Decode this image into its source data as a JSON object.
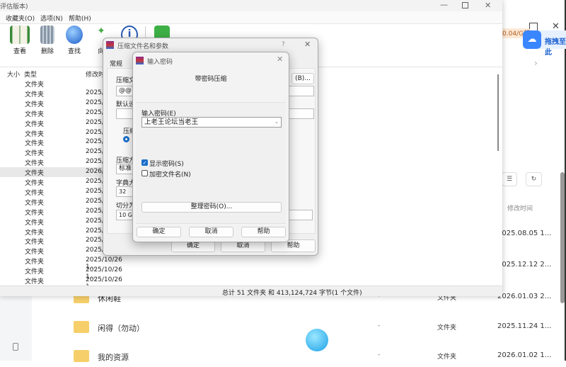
{
  "background_app": {
    "speed_badge": "0.04/G起",
    "drag_upload": "拖拽至此",
    "col_modified": "修改时间",
    "rows": [
      {
        "name": "",
        "type": "",
        "date": "2025.08.05 1..."
      },
      {
        "name": "",
        "type": "",
        "date": "2025.12.12 2..."
      },
      {
        "name": "休闲鞋",
        "type": "文件夹",
        "date": "2026.01.03 2..."
      },
      {
        "name": "闲得（勿动）",
        "type": "文件夹",
        "date": "2025.11.24 1..."
      },
      {
        "name": "我的资源",
        "type": "文件夹",
        "date": "2026.01.02 1..."
      }
    ],
    "dash": "-"
  },
  "winrar": {
    "title": "评估版本)",
    "menu": [
      "收藏夹(O)",
      "选项(N)",
      "帮助(H)"
    ],
    "toolbar": [
      "查看",
      "删除",
      "查找",
      "向",
      "",
      ""
    ],
    "columns": {
      "size": "大小",
      "type": "类型",
      "modified": "修改时"
    },
    "rows": [
      {
        "type": "文件夹",
        "date": ""
      },
      {
        "type": "文件夹",
        "date": "2025/"
      },
      {
        "type": "文件夹",
        "date": "2025/"
      },
      {
        "type": "文件夹",
        "date": "2025/"
      },
      {
        "type": "文件夹",
        "date": "2025/"
      },
      {
        "type": "文件夹",
        "date": "2025/"
      },
      {
        "type": "文件夹",
        "date": "2025/"
      },
      {
        "type": "文件夹",
        "date": "2025/"
      },
      {
        "type": "文件夹",
        "date": "2025/"
      },
      {
        "type": "文件夹",
        "date": "2026/"
      },
      {
        "type": "文件夹",
        "date": "2025/"
      },
      {
        "type": "文件夹",
        "date": "2025/"
      },
      {
        "type": "文件夹",
        "date": "2025/"
      },
      {
        "type": "文件夹",
        "date": "2025/"
      },
      {
        "type": "文件夹",
        "date": "2025/"
      },
      {
        "type": "文件夹",
        "date": "2025/"
      },
      {
        "type": "文件夹",
        "date": "2025/"
      },
      {
        "type": "文件夹",
        "date": "2025/"
      },
      {
        "type": "文件夹",
        "date": "2025/10/26 1..."
      },
      {
        "type": "文件夹",
        "date": "2025/10/26 1..."
      },
      {
        "type": "文件夹",
        "date": "2025/10/26 1..."
      }
    ],
    "status": "总计 51 文件夹 和 413,124,724 字节(1 个文件)"
  },
  "archive_dialog": {
    "title": "压缩文件名和参数",
    "help_q": "?",
    "tab": "常规",
    "archive_name_label": "压缩文",
    "archive_name_value": "@@西",
    "browse": "(B)...",
    "default_label": "默认设",
    "format_label": "压缩",
    "method_label": "压缩方",
    "method_value": "标准",
    "dict_label": "字典大",
    "dict_value": "32",
    "split_label": "切分为",
    "split_value": "10 GB",
    "ok": "确定",
    "cancel": "取消",
    "help": "帮助"
  },
  "password_dialog": {
    "title": "输入密码",
    "heading": "带密码压缩",
    "password_label": "输入密码(E)",
    "password_value": "上老王论坛当老王",
    "show_password": "显示密码(S)",
    "show_password_checked": true,
    "encrypt_names": "加密文件名(N)",
    "encrypt_names_checked": false,
    "organize": "整理密码(O)...",
    "ok": "确定",
    "cancel": "取消",
    "help": "帮助"
  }
}
